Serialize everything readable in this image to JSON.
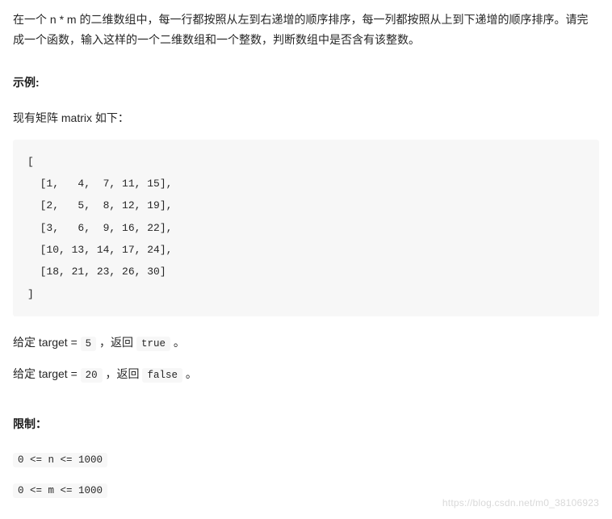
{
  "description": "在一个 n * m 的二维数组中，每一行都按照从左到右递增的顺序排序，每一列都按照从上到下递增的顺序排序。请完成一个函数，输入这样的一个二维数组和一个整数，判断数组中是否含有该整数。",
  "example": {
    "title": "示例:",
    "intro": "现有矩阵 matrix 如下：",
    "matrix": "[\n  [1,   4,  7, 11, 15],\n  [2,   5,  8, 12, 19],\n  [3,   6,  9, 16, 22],\n  [10, 13, 14, 17, 24],\n  [18, 21, 23, 26, 30]\n]",
    "case1_prefix": "给定 target = ",
    "case1_value": "5",
    "case1_mid": " ，返回 ",
    "case1_result": "true",
    "case1_suffix": " 。",
    "case2_prefix": "给定 target = ",
    "case2_value": "20",
    "case2_mid": " ，返回 ",
    "case2_result": "false",
    "case2_suffix": " 。"
  },
  "constraints": {
    "title": "限制：",
    "c1": "0 <= n <= 1000",
    "c2": "0 <= m <= 1000"
  },
  "watermark": "https://blog.csdn.net/m0_38106923"
}
